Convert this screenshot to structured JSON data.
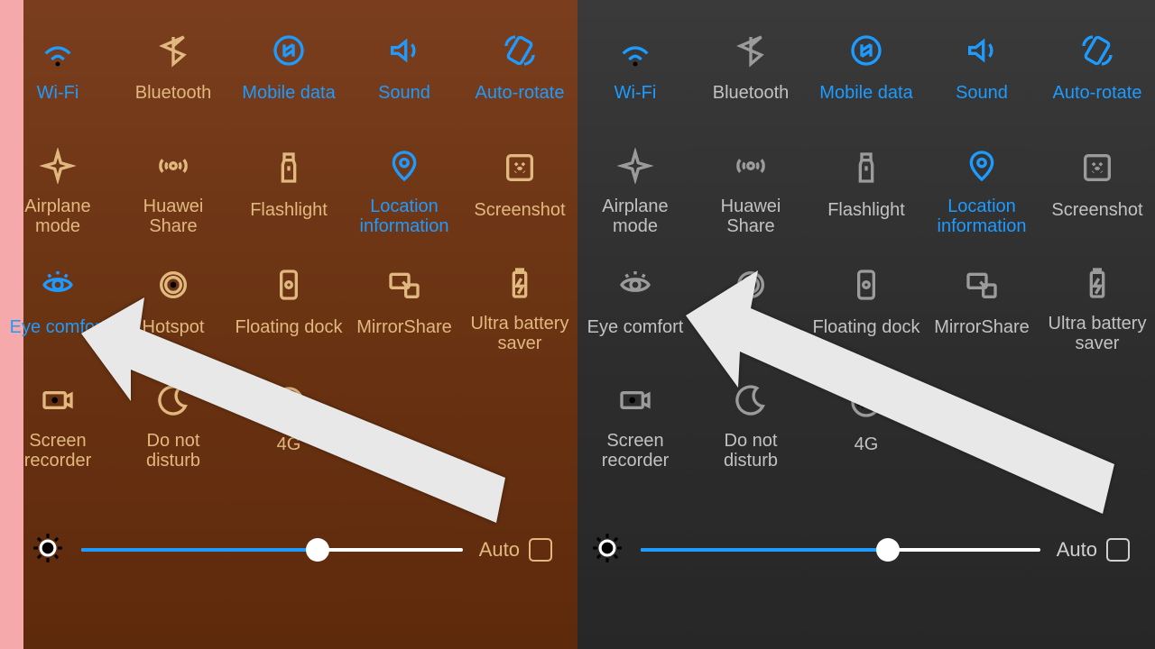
{
  "brightness": {
    "percent": 62,
    "auto_label": "Auto",
    "auto_checked": false
  },
  "toggles": [
    {
      "id": "wifi",
      "label": "Wi-Fi",
      "on": true,
      "icon": "wifi-icon"
    },
    {
      "id": "bluetooth",
      "label": "Bluetooth",
      "on": false,
      "icon": "bluetooth-icon"
    },
    {
      "id": "mobiledata",
      "label": "Mobile data",
      "on": true,
      "icon": "mobile-data-icon"
    },
    {
      "id": "sound",
      "label": "Sound",
      "on": true,
      "icon": "sound-icon"
    },
    {
      "id": "autorotate",
      "label": "Auto-rotate",
      "on": true,
      "icon": "auto-rotate-icon"
    },
    {
      "id": "airplane",
      "label": "Airplane mode",
      "on": false,
      "icon": "airplane-icon"
    },
    {
      "id": "huaweishare",
      "label": "Huawei Share",
      "on": false,
      "icon": "huawei-share-icon"
    },
    {
      "id": "flashlight",
      "label": "Flashlight",
      "on": false,
      "icon": "flashlight-icon"
    },
    {
      "id": "location",
      "label": "Location information",
      "on": true,
      "icon": "location-icon"
    },
    {
      "id": "screenshot",
      "label": "Screenshot",
      "on": false,
      "icon": "screenshot-icon"
    },
    {
      "id": "eyecomfort",
      "label": "Eye comfort",
      "on": true,
      "icon": "eye-comfort-icon"
    },
    {
      "id": "hotspot",
      "label": "Hotspot",
      "on": false,
      "icon": "hotspot-icon"
    },
    {
      "id": "floatdock",
      "label": "Floating dock",
      "on": false,
      "icon": "floating-dock-icon"
    },
    {
      "id": "mirrorshare",
      "label": "MirrorShare",
      "on": false,
      "icon": "mirror-share-icon"
    },
    {
      "id": "ultrabattery",
      "label": "Ultra battery saver",
      "on": false,
      "icon": "battery-saver-icon"
    },
    {
      "id": "screenrec",
      "label": "Screen recorder",
      "on": false,
      "icon": "screen-recorder-icon"
    },
    {
      "id": "dnd",
      "label": "Do not disturb",
      "on": false,
      "icon": "do-not-disturb-icon"
    },
    {
      "id": "4g",
      "label": "4G",
      "on": false,
      "icon": "four-g-icon"
    }
  ],
  "right_overrides": {
    "eyecomfort": {
      "on": false
    }
  }
}
